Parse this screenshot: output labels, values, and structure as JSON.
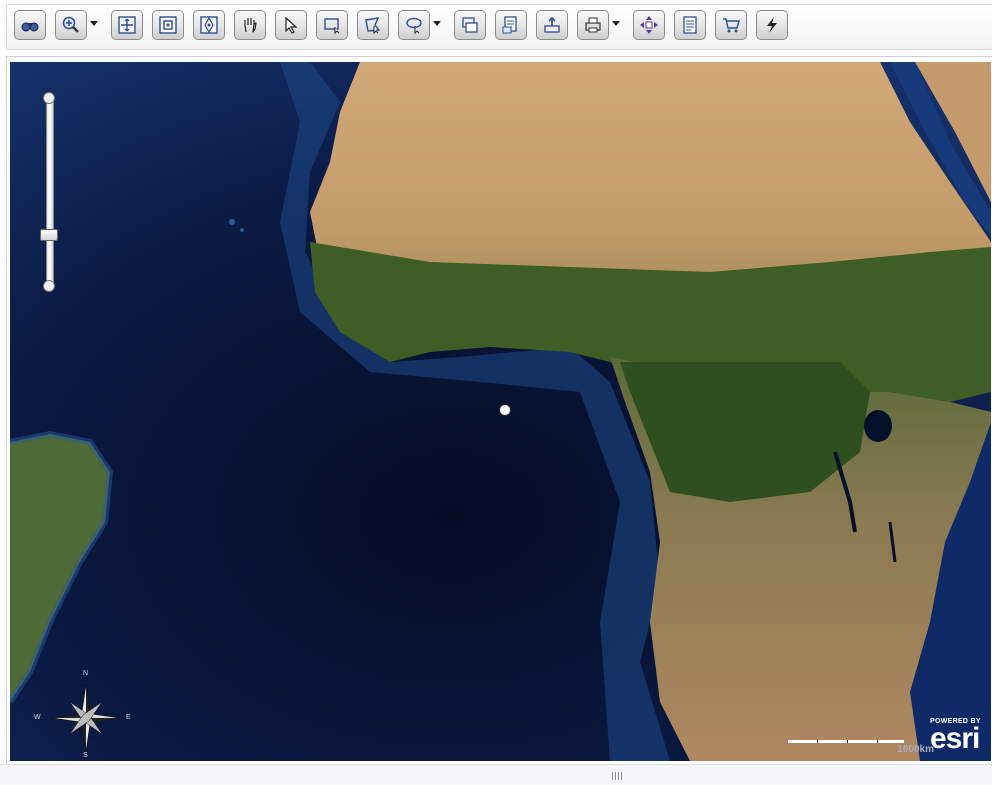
{
  "toolbar": {
    "buttons": [
      {
        "name": "overview-button",
        "icon": "binoculars-icon"
      },
      {
        "name": "zoom-in-button",
        "icon": "magnifier-plus-icon",
        "dropdown": true
      },
      {
        "name": "full-extent-button",
        "icon": "full-extent-icon"
      },
      {
        "name": "zoom-previous-button",
        "icon": "zoom-box-icon"
      },
      {
        "name": "zoom-next-button",
        "icon": "zoom-target-icon"
      },
      {
        "name": "pan-button",
        "icon": "hand-icon"
      },
      {
        "name": "select-button",
        "icon": "arrow-cursor-icon"
      },
      {
        "name": "select-rectangle-button",
        "icon": "rectangle-select-icon"
      },
      {
        "name": "select-polygon-button",
        "icon": "polygon-select-icon"
      },
      {
        "name": "select-tools-button",
        "icon": "lasso-select-icon",
        "dropdown": true
      },
      {
        "name": "layers-button",
        "icon": "layers-icon"
      },
      {
        "name": "identify-button",
        "icon": "identify-icon"
      },
      {
        "name": "export-button",
        "icon": "export-icon"
      },
      {
        "name": "print-button",
        "icon": "printer-icon",
        "dropdown": true
      },
      {
        "name": "navigate-button",
        "icon": "four-arrows-icon"
      },
      {
        "name": "report-button",
        "icon": "report-icon"
      },
      {
        "name": "cart-button",
        "icon": "cart-icon"
      },
      {
        "name": "quick-button",
        "icon": "lightning-icon"
      }
    ]
  },
  "map": {
    "compass": {
      "n": "N",
      "s": "S",
      "e": "E",
      "w": "W"
    },
    "scale_label": "1000km",
    "attribution": {
      "powered_by": "POWERED BY",
      "brand": "esri"
    },
    "zoom_level_fraction": 0.27
  },
  "colors": {
    "ocean": "#0a1a3e",
    "land_desert": "#c9a070",
    "land_forest": "#3d5a24",
    "accent": "#ffffff"
  }
}
